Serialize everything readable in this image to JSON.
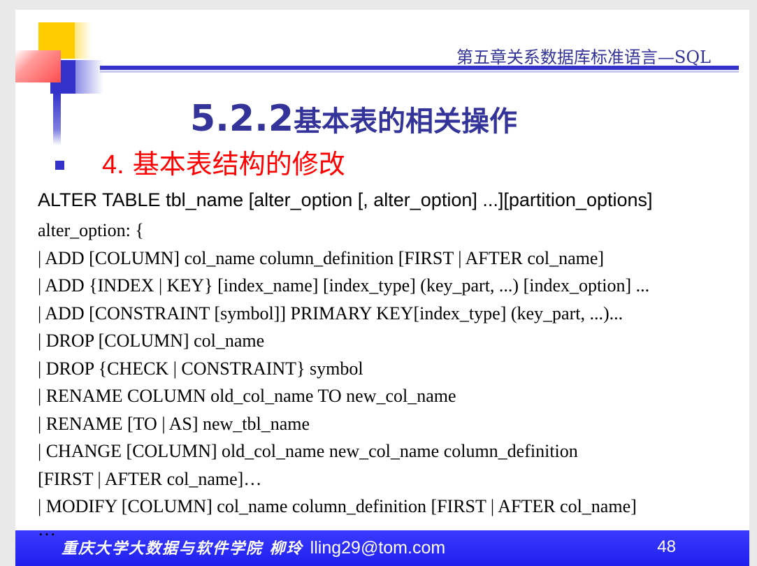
{
  "header": {
    "chapter_title": "第五章关系数据库标准语言—SQL"
  },
  "title": {
    "section_number": "5.2.2",
    "section_text": "基本表的相关操作"
  },
  "subheading": {
    "number": "4.",
    "text": " 基本表结构的修改"
  },
  "syntax_header": "ALTER TABLE tbl_name [alter_option [, alter_option] ...][partition_options]",
  "code_lines": [
    "alter_option: {",
    "| ADD [COLUMN] col_name column_definition [FIRST | AFTER col_name]",
    "| ADD {INDEX | KEY} [index_name] [index_type] (key_part, ...) [index_option] ...",
    "| ADD [CONSTRAINT [symbol]] PRIMARY KEY[index_type] (key_part, ...)...",
    "| DROP [COLUMN] col_name",
    "| DROP {CHECK | CONSTRAINT} symbol",
    "| RENAME COLUMN old_col_name TO new_col_name",
    "| RENAME [TO | AS] new_tbl_name",
    "| CHANGE [COLUMN] old_col_name new_col_name column_definition",
    "[FIRST | AFTER col_name]…",
    "| MODIFY [COLUMN] col_name column_definition [FIRST | AFTER col_name]"
  ],
  "footer": {
    "ellipsis": "…",
    "org": "重庆大学大数据与软件学院 柳玲",
    "email": "lling29@tom.com",
    "page_number": "48"
  },
  "colors": {
    "accent_blue": "#3333cc",
    "title_blue": "#333399",
    "subheading_red": "#ff0000",
    "footer_blue": "#2a2af5"
  }
}
